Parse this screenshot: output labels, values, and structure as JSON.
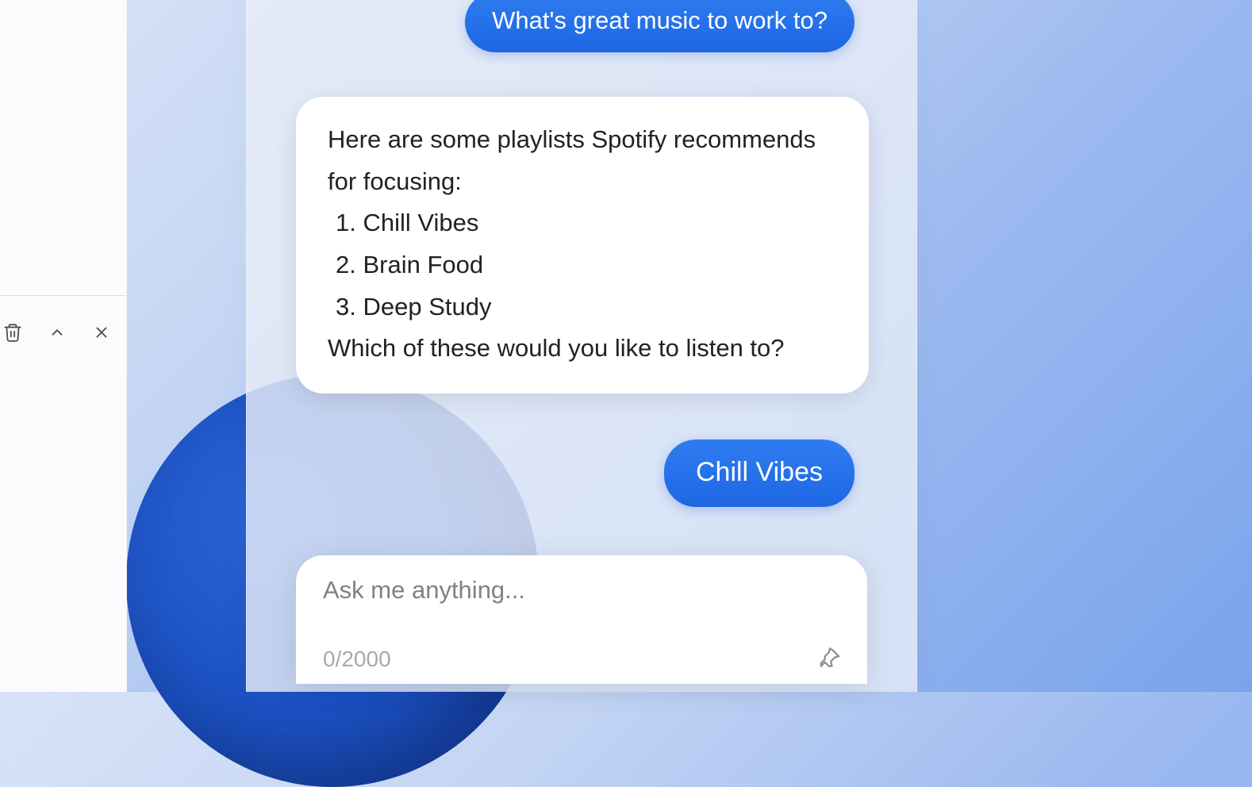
{
  "chat": {
    "messages": {
      "user1": "What's great music to work to?",
      "bot1_intro": "Here are some playlists Spotify recommends for focusing:",
      "bot1_items": {
        "i1": "1. Chill Vibes",
        "i2": "2. Brain Food",
        "i3": "3. Deep Study"
      },
      "bot1_outro": "Which of these would you like to listen to?",
      "user2": "Chill Vibes"
    }
  },
  "composer": {
    "placeholder": "Ask me anything...",
    "char_count": "0/2000"
  }
}
